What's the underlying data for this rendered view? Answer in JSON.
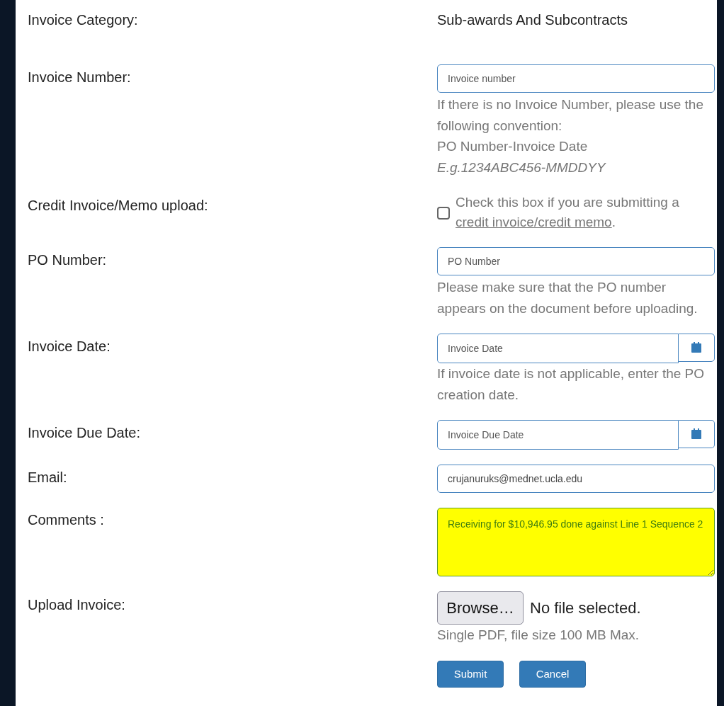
{
  "rows": [
    {
      "kind": "text",
      "label": "Invoice Category:",
      "value": "Sub-awards And Subcontracts"
    },
    {
      "kind": "input",
      "label": "Invoice Number:",
      "placeholder": "Invoice number",
      "hint": [
        "If there is no Invoice Number, please use the following convention:",
        "PO Number-Invoice Date",
        "*E.g.1234ABC456-MMDDYY*"
      ]
    },
    {
      "kind": "checkbox",
      "label": "Credit Invoice/Memo upload:",
      "checked": false,
      "text_before": "Check this box if you are submitting a ",
      "link": "credit invoice/credit memo",
      "text_after": "."
    },
    {
      "kind": "input",
      "label": "PO Number:",
      "placeholder": "PO Number",
      "hint": [
        "Please make sure that the PO number appears on the document before uploading."
      ]
    },
    {
      "kind": "date",
      "label": "Invoice Date:",
      "placeholder": "Invoice Date",
      "hint": [
        "If invoice date is not applicable, enter the PO creation date."
      ]
    },
    {
      "kind": "date",
      "label": "Invoice Due Date:",
      "placeholder": "Invoice Due Date"
    },
    {
      "kind": "input",
      "label": "Email:",
      "value": "crujanuruks@mednet.ucla.edu"
    },
    {
      "kind": "textarea",
      "label": "Comments :",
      "value": "Receiving for $10,946.95 done against Line 1 Sequence 2"
    },
    {
      "kind": "file",
      "label": "Upload Invoice:",
      "button": "Browse…",
      "status": "No file selected.",
      "hint": [
        "Single PDF, file size 100 MB Max."
      ]
    }
  ],
  "buttons": [
    "Submit",
    "Cancel"
  ]
}
